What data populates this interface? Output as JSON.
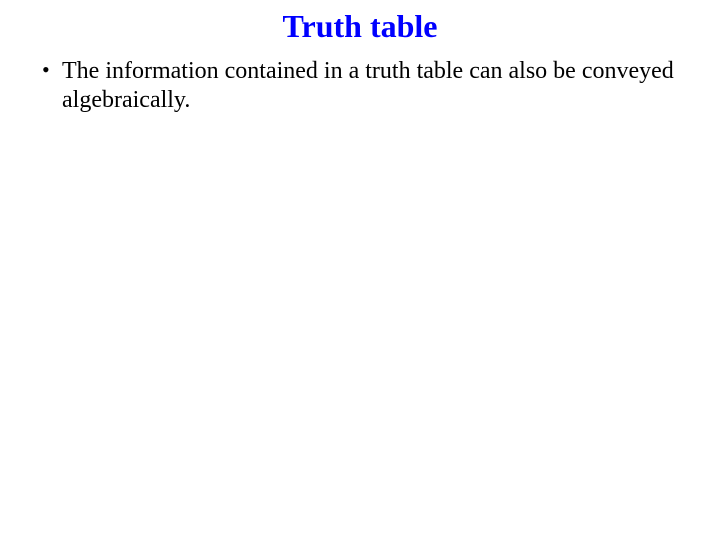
{
  "slide": {
    "title": "Truth table",
    "bullets": [
      "The information contained in a truth table can also be conveyed algebraically."
    ]
  }
}
